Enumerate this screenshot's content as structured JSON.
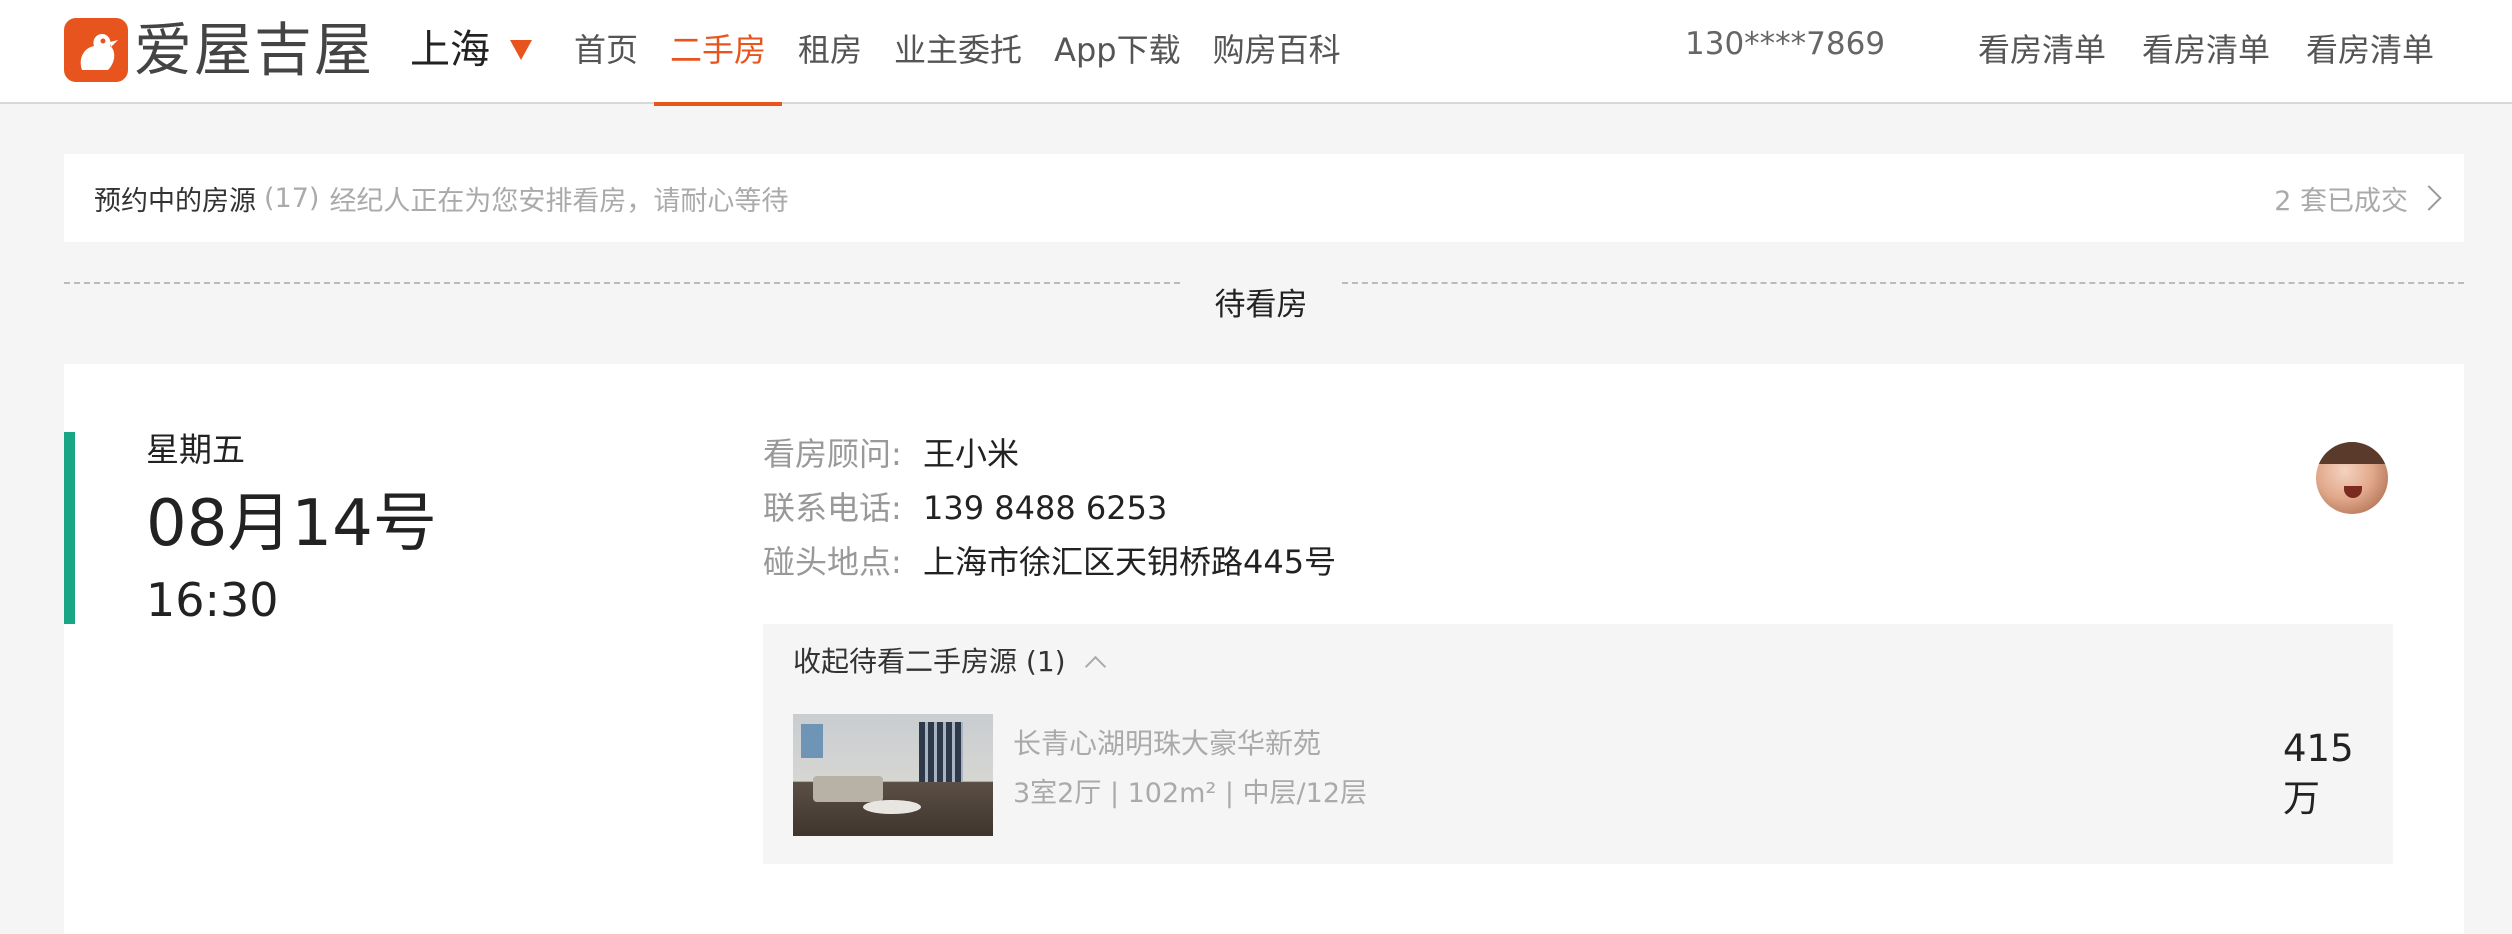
{
  "header": {
    "logo_text": "爱屋吉屋",
    "city": "上海",
    "nav": [
      "首页",
      "二手房",
      "租房",
      "业主委托",
      "App下载",
      "购房百科"
    ],
    "active_nav": "二手房",
    "phone": "130****7869",
    "list_links": [
      "看房清单",
      "看房清单",
      "看房清单"
    ],
    "accent_color": "#e8541e"
  },
  "banner": {
    "title": "预约中的房源",
    "count": "(17)",
    "description": "经纪人正在为您安排看房，请耐心等待",
    "right_link": "2 套已成交"
  },
  "section": {
    "label": "待看房"
  },
  "appointment": {
    "weekday": "星期五",
    "date": "08月14号",
    "time": "16:30",
    "accent_color": "#18a685",
    "advisor_label": "看房顾问:",
    "advisor": "王小米",
    "phone_label": "联系电话:",
    "phone": "139 8488 6253",
    "location_label": "碰头地点:",
    "location": "上海市徐汇区天钥桥路445号",
    "houses_toggle": "收起待看二手房源 (1)",
    "house": {
      "name": "长青心湖明珠大豪华新苑",
      "meta": "3室2厅  |  102m²  |  中层/12层",
      "price": "415 万"
    }
  }
}
